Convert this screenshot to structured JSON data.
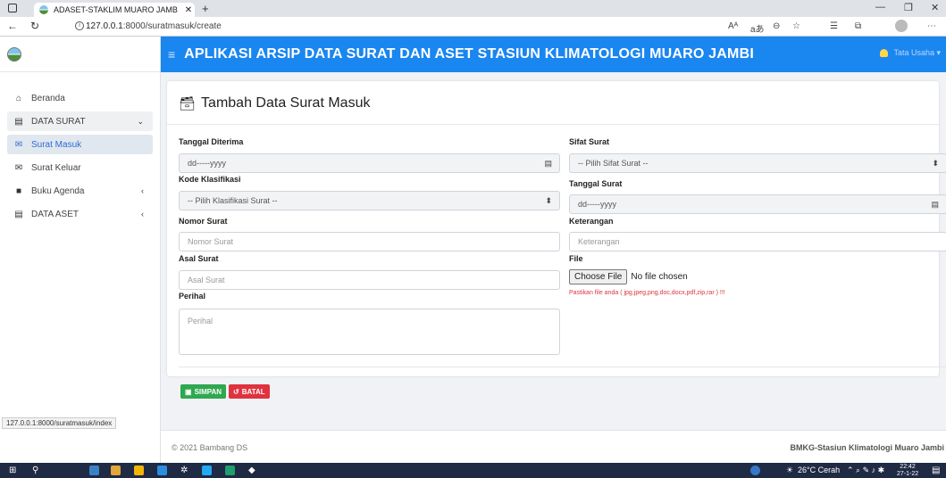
{
  "browser": {
    "tab_title": "ADASET-STAKLIM MUARO JAMB",
    "url_host": "127.0.0.1",
    "url_rest": ":8000/suratmasuk/create",
    "reader_label": "Aᴬ",
    "read_aloud_label": "aあ",
    "status_url": "127.0.0.1:8000/suratmasuk/index"
  },
  "topbar": {
    "title": "APLIKASI ARSIP DATA SURAT DAN ASET STASIUN KLIMATOLOGI MUARO JAMBI",
    "user": "Tata Usaha"
  },
  "sidebar": {
    "items": [
      {
        "label": "Beranda",
        "icon": "home-icon"
      },
      {
        "label": "DATA SURAT",
        "icon": "archive-icon"
      },
      {
        "label": "Surat Masuk",
        "icon": "envelope-icon"
      },
      {
        "label": "Surat Keluar",
        "icon": "envelope-open-icon"
      },
      {
        "label": "Buku Agenda",
        "icon": "book-icon"
      },
      {
        "label": "DATA ASET",
        "icon": "archive-icon"
      }
    ]
  },
  "form": {
    "title": "Tambah Data Surat Masuk",
    "tanggal_diterima": {
      "label": "Tanggal Diterima",
      "placeholder": "dd-----yyyy"
    },
    "kode_klasifikasi": {
      "label": "Kode Klasifikasi",
      "value": "-- Pilih Klasifikasi Surat --"
    },
    "nomor_surat": {
      "label": "Nomor Surat",
      "placeholder": "Nomor Surat"
    },
    "asal_surat": {
      "label": "Asal Surat",
      "placeholder": "Asal Surat"
    },
    "perihal": {
      "label": "Perihal",
      "placeholder": "Perihal"
    },
    "sifat_surat": {
      "label": "Sifat Surat",
      "value": "-- Pilih Sifat Surat --"
    },
    "tanggal_surat": {
      "label": "Tanggal Surat",
      "placeholder": "dd-----yyyy"
    },
    "keterangan": {
      "label": "Keterangan",
      "placeholder": "Keterangan"
    },
    "file": {
      "label": "File",
      "button": "Choose File",
      "status": "No file chosen",
      "note": "Pastikan file anda ( jpg,jpeg,png,doc,docx,pdf,zip,rar ) !!!"
    },
    "save_label": "SIMPAN",
    "cancel_label": "BATAL"
  },
  "footer": {
    "left": "© 2021 Bambang DS",
    "right": "BMKG-Stasiun Klimatologi Muaro Jambi"
  },
  "taskbar": {
    "weather": "26°C Cerah",
    "time": "22:42",
    "date": "27-1-22"
  },
  "colors": {
    "topbar": "#1a86f0",
    "save": "#2fa84f",
    "cancel": "#e0323f",
    "active_menu": "#2b6cd6"
  }
}
